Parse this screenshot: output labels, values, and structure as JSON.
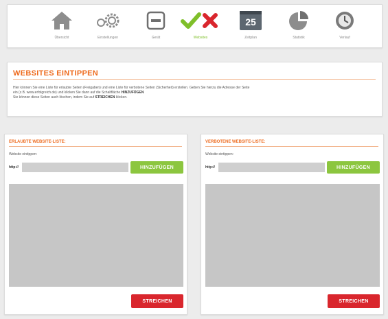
{
  "toolbar": {
    "items": [
      {
        "label": "Übersicht",
        "icon": "home-icon"
      },
      {
        "label": "Einstellungen",
        "icon": "gears-icon"
      },
      {
        "label": "Gerät",
        "icon": "device-icon"
      },
      {
        "label": "Websites",
        "icon": "allow-block-icon"
      },
      {
        "label": "Zeitplan",
        "icon": "calendar-icon"
      },
      {
        "label": "Statistik",
        "icon": "pie-chart-icon"
      },
      {
        "label": "Verlauf",
        "icon": "history-icon"
      }
    ],
    "calendar_day": "25",
    "active_color": "#7fbf2a"
  },
  "page": {
    "title": "WEBSITES EINTIPPEN",
    "desc_line1": "Hier können Sie eine Liste für erlaubte Seiten (Freigaben) und eine Liste für verbotene Seiten (Sicherheit) erstellen. Geben Sie hierzu die Adresse der Seite",
    "desc_line2a": "ein (z.B. www.erfolgreich.de) und klicken Sie dann auf die Schaltfläche ",
    "desc_line2b": "HINZUFÜGEN",
    "desc_line3a": "Sie können diese Seiten auch löschen, indem Sie auf ",
    "desc_line3b": "STREICHEN",
    "desc_line3c": " klicken."
  },
  "allowed": {
    "title": "ERLAUBTE WEBSITE-LISTE:",
    "hint": "Website eintippen:",
    "prefix": "http://",
    "input_value": "",
    "add_label": "HINZUFÜGEN",
    "delete_label": "STREICHEN"
  },
  "blocked": {
    "title": "VERBOTENE WEBSITE-LISTE:",
    "hint": "Website eintippen:",
    "prefix": "http://",
    "input_value": "",
    "add_label": "HINZUFÜGEN",
    "delete_label": "STREICHEN"
  },
  "colors": {
    "accent_orange": "#ee6b1e",
    "add_green": "#8cc63f",
    "delete_red": "#d9262d"
  }
}
